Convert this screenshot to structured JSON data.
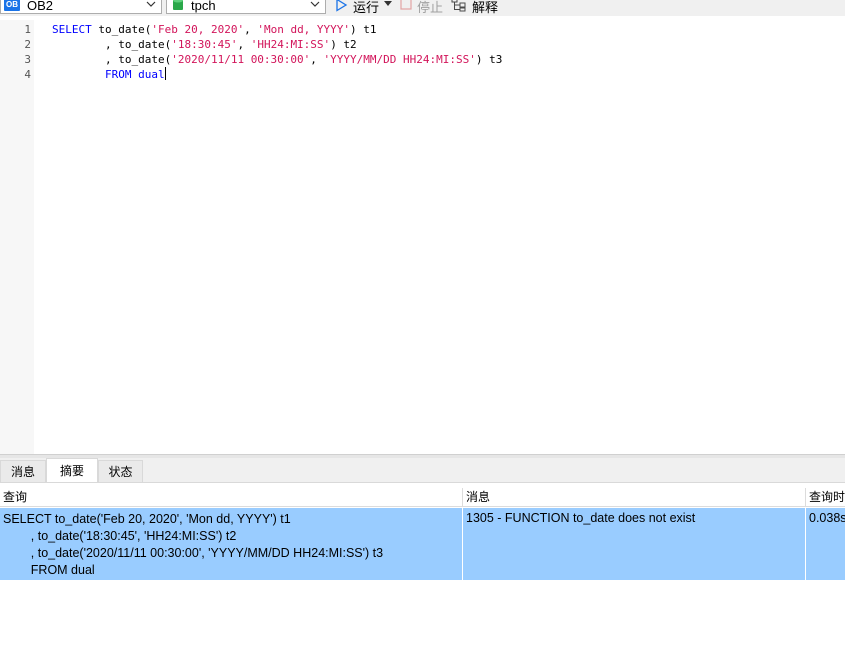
{
  "toolbar": {
    "connection": {
      "icon": "ob-logo-icon",
      "icon_text": "OB",
      "value": "OB2"
    },
    "database": {
      "icon": "database-icon",
      "value": "tpch"
    },
    "run_label": "运行",
    "stop_label": "停止",
    "explain_label": "解释"
  },
  "editor": {
    "line_numbers": [
      "1",
      "2",
      "3",
      "4"
    ],
    "lines": [
      {
        "kw": "SELECT",
        "plain1": " to_date(",
        "s1": "'Feb 20, 2020'",
        "plain2": ", ",
        "s2": "'Mon dd, YYYY'",
        "plain3": ") t1"
      },
      {
        "plain1": "        , to_date(",
        "s1": "'18:30:45'",
        "plain2": ", ",
        "s2": "'HH24:MI:SS'",
        "plain3": ") t2"
      },
      {
        "plain1": "        , to_date(",
        "s1": "'2020/11/11 00:30:00'",
        "plain2": ", ",
        "s2": "'YYYY/MM/DD HH24:MI:SS'",
        "plain3": ") t3"
      },
      {
        "indent": "        ",
        "kw": "FROM dual"
      }
    ]
  },
  "tabs": [
    {
      "label": "消息"
    },
    {
      "label": "摘要"
    },
    {
      "label": "状态"
    }
  ],
  "result": {
    "columns": [
      "查询",
      "消息",
      "查询时"
    ],
    "row": {
      "query_lines": [
        "SELECT to_date('Feb 20, 2020', 'Mon dd, YYYY') t1",
        "        , to_date('18:30:45', 'HH24:MI:SS') t2",
        "        , to_date('2020/11/11 00:30:00', 'YYYY/MM/DD HH24:MI:SS') t3",
        "        FROM dual"
      ],
      "message": "1305 - FUNCTION to_date does not exist",
      "time": "0.038s"
    }
  },
  "colors": {
    "keyword": "#0000ff",
    "string": "#d2145a",
    "selected_row": "#99ccff",
    "run_icon": "#1a73e8"
  }
}
